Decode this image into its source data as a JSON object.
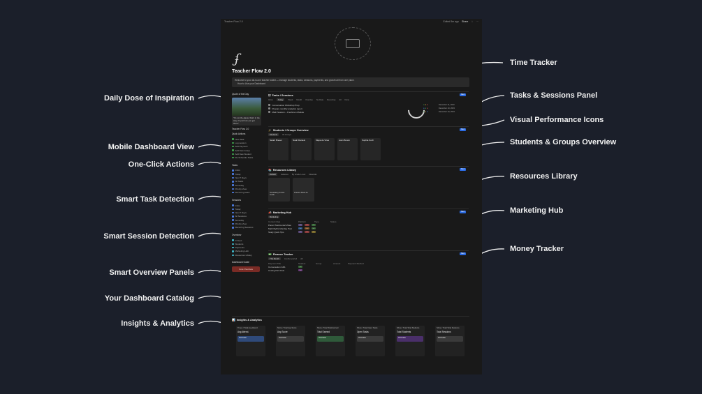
{
  "callouts_left": [
    {
      "label": "Daily Dose of Inspiration"
    },
    {
      "label": "Mobile Dashboard View"
    },
    {
      "label": "One-Click Actions"
    },
    {
      "label": "Smart Task Detection"
    },
    {
      "label": "Smart Session Detection"
    },
    {
      "label": "Smart Overview Panels"
    },
    {
      "label": "Your Dashboard Catalog"
    },
    {
      "label": "Insights & Analytics"
    }
  ],
  "callouts_right": [
    {
      "label": "Time Tracker"
    },
    {
      "label": "Tasks & Sessions Panel"
    },
    {
      "label": "Visual Performance Icons"
    },
    {
      "label": "Students & Groups Overview"
    },
    {
      "label": "Resources Library"
    },
    {
      "label": "Marketing Hub"
    },
    {
      "label": "Money Tracker"
    }
  ],
  "app": {
    "breadcrumb": "Teacher Flow 2.0",
    "topbar_right": [
      "Edited 5m ago",
      "Share"
    ],
    "page_title": "Teacher Flow 2.0",
    "welcome_line1": "Welcome to your all-in-one teacher toolkit — manage students, tasks, sessions, payments, and growth all from one place.",
    "welcome_line2": "How to Use your Dashboard",
    "sidebar": {
      "quote_heading": "Quote of the Day",
      "quote_text": "\"It's not the glacier that's in the way, it's just how you get there.\"",
      "mobile_heading": "Teacher Flow 2.0",
      "quick_heading": "Quick Actions",
      "quick_items": [
        "New Task",
        "Log session",
        "Add Payment",
        "Add New Group",
        "Add New Student",
        "Re-Schedule Tasks"
      ],
      "tasks_heading": "Tasks",
      "tasks_items": [
        "Inbox",
        "Today",
        "Next 7 Days",
        "All Tasks",
        "Someday",
        "Priority View",
        "Recurring tasks"
      ],
      "sessions_heading": "Sessions",
      "sessions_items": [
        "Inbox",
        "Today",
        "Next 7 Days",
        "All Sessions",
        "Someday",
        "Priority View",
        "Recurring Sessions"
      ],
      "overview_heading": "Overview",
      "overview_items": [
        "Groups",
        "Students",
        "Payments",
        "Marketing Hub",
        "Resources Library"
      ],
      "catalog_heading": "Dashboard Guide",
      "guide_button": "Core Overview"
    },
    "tasks_panel": {
      "title": "Tasks / Sessions",
      "tabs": [
        "Inbox",
        "Today",
        "Week",
        "Month",
        "Overdue",
        "No Date",
        "Recurring",
        "All",
        "Done"
      ],
      "rows": [
        "Conversation Workshop Prep",
        "Prepare monthly analytics report",
        "Math Session – Freshmen Module"
      ],
      "dates": [
        "December 11, 2023",
        "December 10, 2023",
        "December 10, 2023"
      ],
      "new_label": "New"
    },
    "students_panel": {
      "title": "Students / Groups Overview",
      "tabs": [
        "Students",
        "All Groups"
      ],
      "cards": [
        "Sarah Breuer",
        "Noah Daniels",
        "Maya de Vries",
        "Liam Brown",
        "Sophia Koch"
      ],
      "new_label": "New"
    },
    "resources_panel": {
      "title": "Resources Library",
      "tabs": [
        "Default",
        "Galleries",
        "By Grade Level",
        "Materials"
      ],
      "cards": [
        "Vocabulary Puzzle Guide",
        "Practice Book A1"
      ],
      "new_label": "New"
    },
    "marketing_panel": {
      "title": "Marketing Hub",
      "tabs": [
        "Marketing"
      ],
      "columns": [
        "Content Idea",
        "Platform",
        "Type",
        "Status"
      ],
      "rows": [
        "Parent Testimonial Video",
        "Math Myths Monday Post",
        "Study Quick Tips"
      ],
      "new_label": "New"
    },
    "finance_panel": {
      "title": "Finance Tracker",
      "tabs": [
        "This Month",
        "Another period",
        "All"
      ],
      "columns": [
        "Payment Title",
        "Student",
        "Group",
        "Amount",
        "Payment Method"
      ],
      "rows": [
        "Conversation GR1",
        "Coding Part FGH"
      ],
      "new_label": "New"
    },
    "insights": {
      "title": "Insights & Analytics",
      "columns": [
        {
          "caption": "Times / Total Avg Attend.",
          "heading": "Avg Attend.",
          "color": "#2f4a7a"
        },
        {
          "caption": "Show / Total Avg Score",
          "heading": "Avg Score",
          "color": "#3a3a3a"
        },
        {
          "caption": "Show / Total Total Earned",
          "heading": "Total Earned",
          "color": "#2f5a3a"
        },
        {
          "caption": "Show / Total Open Tasks",
          "heading": "Open Tasks",
          "color": "#3a3a3a"
        },
        {
          "caption": "Show / Total Total Students",
          "heading": "Total Students",
          "color": "#4a2f6a"
        },
        {
          "caption": "Show / Total Total Sessions",
          "heading": "Total Sessions",
          "color": "#3a3a3a"
        }
      ],
      "bar_label": "Overview"
    }
  }
}
